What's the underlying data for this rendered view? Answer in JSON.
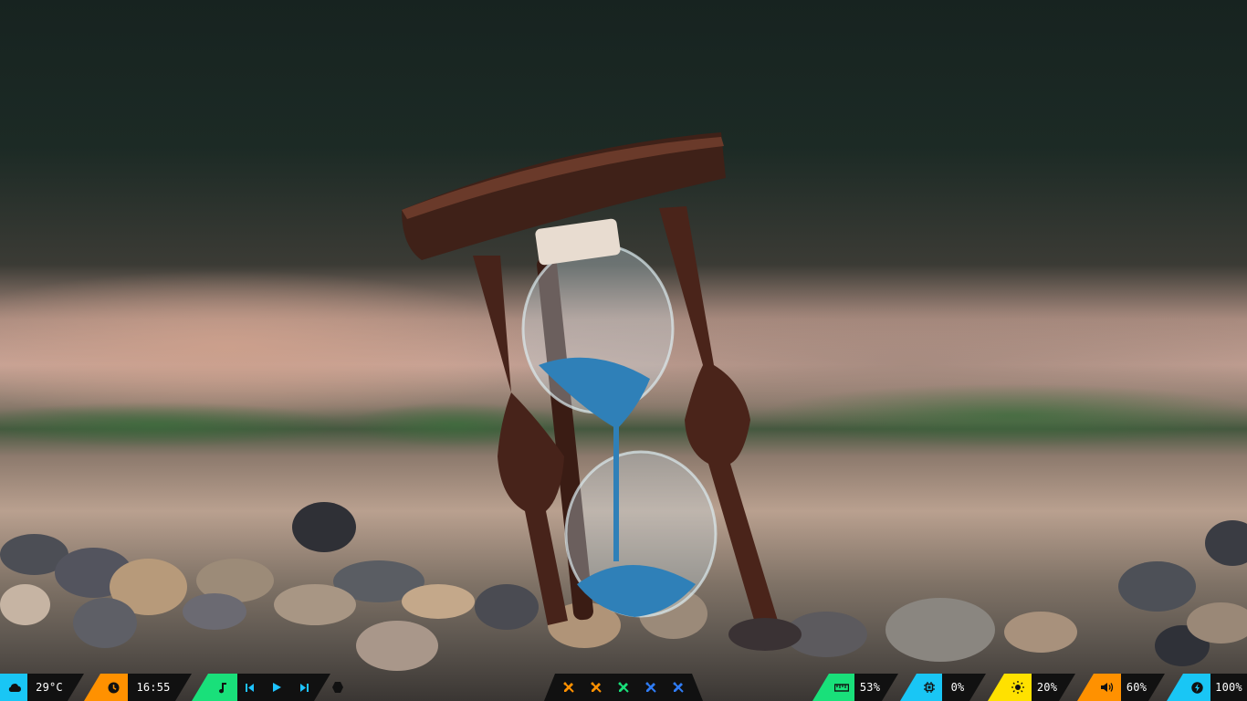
{
  "wallpaper": {
    "subject": "hourglass on pebbles",
    "sand_color": "#2f80b8"
  },
  "bar": {
    "weather": {
      "icon": "cloud-icon",
      "value": "29°C",
      "accent": "#19c6f5"
    },
    "clock": {
      "icon": "clock-icon",
      "value": "16:55",
      "accent": "#ff9100"
    },
    "music": {
      "icon": "music-note-icon",
      "accent": "#19e07a",
      "controls": [
        "previous-icon",
        "play-icon",
        "next-icon"
      ]
    },
    "workspaces": [
      {
        "icon": "pencil-ruler-icon",
        "color": "#ff9100"
      },
      {
        "icon": "pencil-ruler-icon",
        "color": "#ff9100"
      },
      {
        "icon": "pencil-ruler-icon",
        "color": "#19e07a"
      },
      {
        "icon": "pencil-ruler-icon",
        "color": "#2f7cf6"
      },
      {
        "icon": "pencil-ruler-icon",
        "color": "#2f7cf6"
      }
    ],
    "memory": {
      "icon": "ruler-icon",
      "value": "53%",
      "accent": "#19e07a"
    },
    "cpu": {
      "icon": "cpu-icon",
      "value": "0%",
      "accent": "#19c6f5"
    },
    "brightness": {
      "icon": "sun-icon",
      "value": "20%",
      "accent": "#ffe100"
    },
    "volume": {
      "icon": "volume-icon",
      "value": "60%",
      "accent": "#ff9100"
    },
    "battery": {
      "icon": "bolt-icon",
      "value": "100%",
      "accent": "#19c6f5"
    }
  }
}
